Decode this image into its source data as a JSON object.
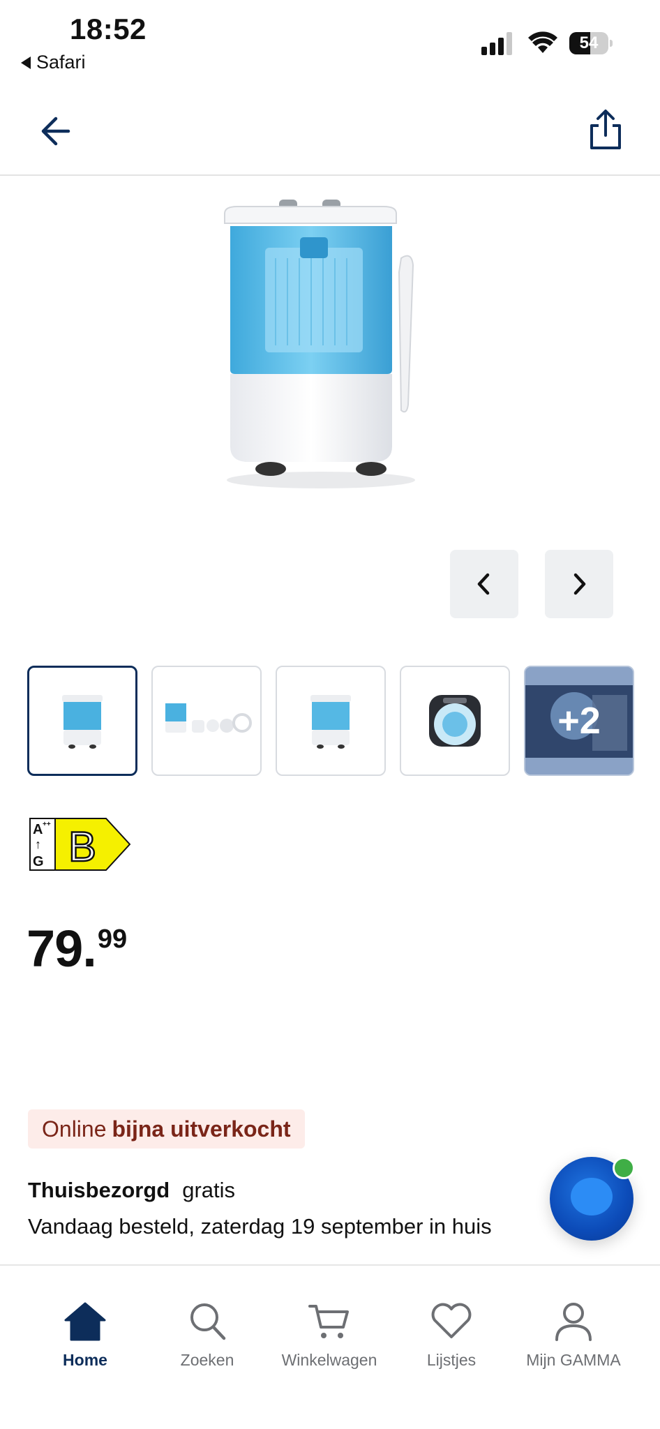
{
  "status_bar": {
    "time": "18:52",
    "back_app": "Safari",
    "battery_level": 54,
    "battery_label": "54"
  },
  "header": {
    "back_icon": "arrow-left-icon",
    "share_icon": "share-icon"
  },
  "gallery": {
    "prev_icon": "chevron-left-icon",
    "next_icon": "chevron-right-icon",
    "active_index": 0,
    "more_label": "+2"
  },
  "energy_label": {
    "class": "B",
    "scale_top": "A",
    "scale_top_sup": "++",
    "scale_arrow": "↑",
    "scale_bottom": "G"
  },
  "price": {
    "main": "79.",
    "cents": "99"
  },
  "stock": {
    "prefix": "Online",
    "status": "bijna uitverkocht"
  },
  "delivery": {
    "label": "Thuisbezorgd",
    "cost": "gratis",
    "eta": "Vandaag besteld, zaterdag 19 september in huis"
  },
  "bottom_nav": {
    "items": [
      {
        "label": "Home",
        "icon": "home-icon",
        "active": true
      },
      {
        "label": "Zoeken",
        "icon": "search-icon",
        "active": false
      },
      {
        "label": "Winkelwagen",
        "icon": "cart-icon",
        "active": false
      },
      {
        "label": "Lijstjes",
        "icon": "heart-icon",
        "active": false
      },
      {
        "label": "Mijn GAMMA",
        "icon": "user-icon",
        "active": false
      }
    ]
  },
  "colors": {
    "brand_navy": "#0d2d5a",
    "stock_bg": "#fdece9",
    "stock_text": "#7a2518",
    "energy_yellow": "#f5f000",
    "chat_blue": "#0c4bb8"
  }
}
